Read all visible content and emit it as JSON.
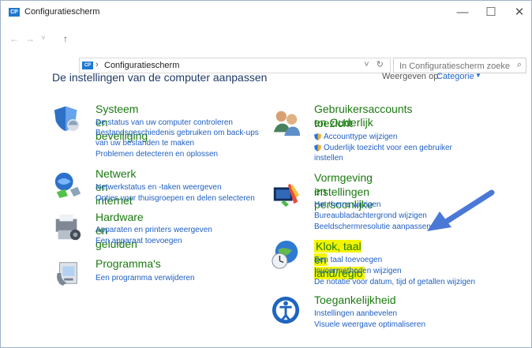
{
  "window": {
    "title": "Configuratiescherm",
    "app_icon_text": "CP",
    "buttons": [
      "—",
      "☐",
      "✕"
    ]
  },
  "nav": {
    "back": "←",
    "forward": "→",
    "dropdown": "˅",
    "up": "↑",
    "address_icon_text": "CP",
    "address_separator": "›",
    "address_path": "Configuratiescherm",
    "address_dropdown": "˅",
    "refresh": "↻",
    "search_placeholder": "In Configuratiescherm zoeken",
    "search_icon": "⌕"
  },
  "page": {
    "heading": "De instellingen van de computer aanpassen",
    "view_by_label": "Weergeven op:",
    "view_by_value": "Categorie",
    "view_by_arrow": "▼"
  },
  "left": [
    {
      "title": "Systeem en beveiliging",
      "links": [
        "De status van uw computer controleren",
        "Bestandsgeschiedenis gebruiken om back-ups",
        "van uw bestanden te maken",
        "Problemen detecteren en oplossen"
      ]
    },
    {
      "title": "Netwerk en internet",
      "links": [
        "Netwerkstatus en -taken weergeven",
        "Opties voor thuisgroepen en delen selecteren"
      ]
    },
    {
      "title": "Hardware en geluiden",
      "links": [
        "Apparaten en printers weergeven",
        "Een apparaat toevoegen"
      ]
    },
    {
      "title": "Programma's",
      "links": [
        "Een programma verwijderen"
      ]
    }
  ],
  "right": [
    {
      "title1": "Gebruikersaccounts en Ouderlijk",
      "title2": "toezicht",
      "links": [
        "Accounttype wijzigen",
        "Ouderlijk toezicht voor een gebruiker",
        "instellen"
      ]
    },
    {
      "title1": "Vormgeving en persoonlijke",
      "title2": "instellingen",
      "links": [
        "Het thema wijzigen",
        "Bureaubladachtergrond wijzigen",
        "Beeldschermresolutie aanpassen"
      ]
    },
    {
      "title": "Klok, taal en land/regio",
      "links": [
        "Een taal toevoegen",
        "Invoermethoden wijzigen",
        "De notatie voor datum, tijd of getallen wijzigen"
      ]
    },
    {
      "title": "Toegankelijkheid",
      "links": [
        "Instellingen aanbevelen",
        "Visuele weergave optimaliseren"
      ]
    }
  ],
  "colors": {
    "category_title": "#1b7a10",
    "link": "#1f5fc4",
    "highlight": "#f4f400",
    "arrow": "#4a78d6"
  },
  "icons": [
    "security-shield-icon",
    "users-icon",
    "network-icon",
    "appearance-icon",
    "hardware-printer-icon",
    "clock-globe-icon",
    "programs-icon",
    "accessibility-icon"
  ]
}
